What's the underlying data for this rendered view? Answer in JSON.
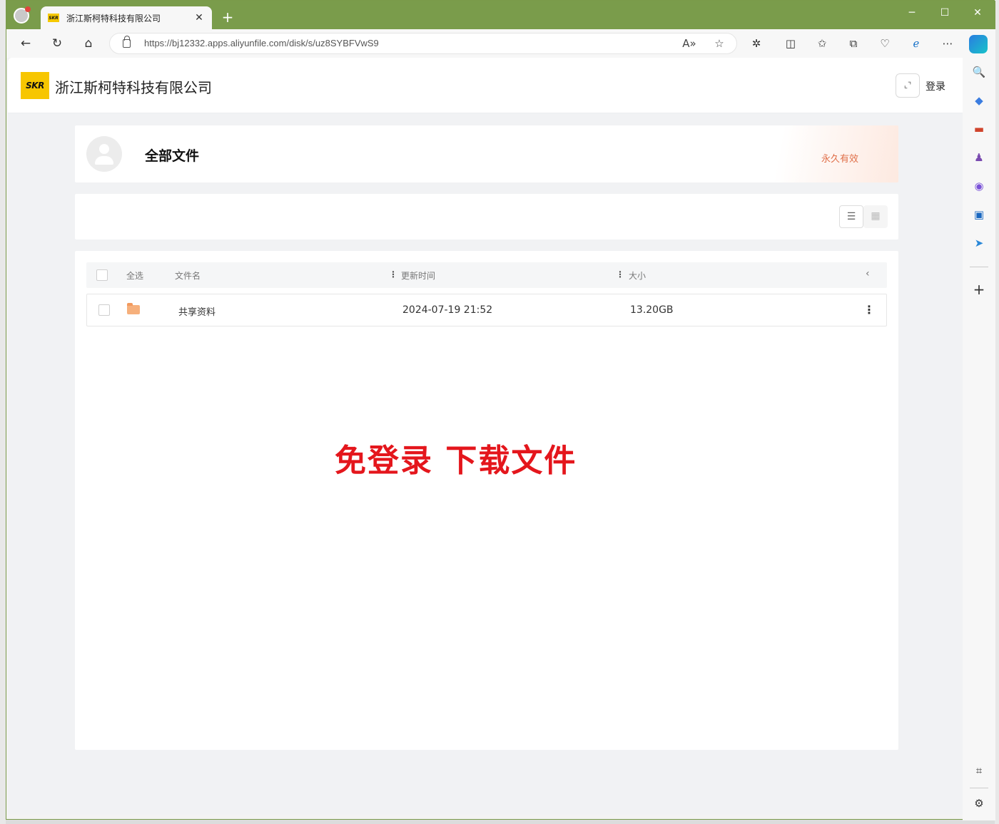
{
  "browser": {
    "tab_title": "浙江斯柯特科技有限公司",
    "favicon_text": "SKR",
    "url": "https://bj12332.apps.aliyunfile.com/disk/s/uz8SYBFVwS9"
  },
  "header": {
    "logo_text": "SKR",
    "company_name": "浙江斯柯特科技有限公司",
    "login_label": "登录"
  },
  "share": {
    "title": "全部文件",
    "validity": "永久有效"
  },
  "table": {
    "select_all": "全选",
    "columns": {
      "name": "文件名",
      "updated": "更新时间",
      "size": "大小"
    },
    "rows": [
      {
        "name": "共享资料",
        "updated": "2024-07-19 21:52",
        "size": "13.20GB"
      }
    ]
  },
  "overlay_text": "免登录 下载文件",
  "colors": {
    "titlebar": "#7a9c4b",
    "logo": "#f7c600",
    "validity": "#e0704a",
    "overlay": "#e4161c"
  }
}
